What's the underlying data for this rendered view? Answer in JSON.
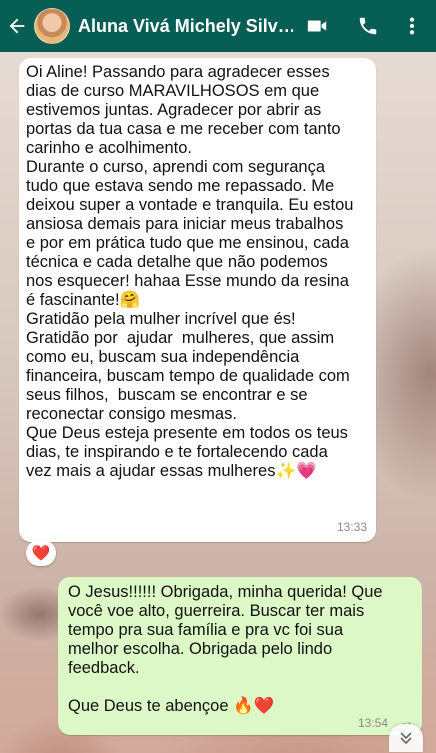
{
  "header": {
    "contact_name": "Aluna Vivá Michely Silv…",
    "back_icon": "arrow-left-icon",
    "video_icon": "video-camera-icon",
    "call_icon": "phone-icon",
    "menu_icon": "more-vertical-icon",
    "bg_color": "#075e54"
  },
  "messages": [
    {
      "direction": "incoming",
      "text": "Oi Aline! Passando para agradecer esses\ndias de curso MARAVILHOSOS em que\nestivemos juntas. Agradecer por abrir as\nportas da tua casa e me receber com tanto\ncarinho e acolhimento.\nDurante o curso, aprendi com segurança\ntudo que estava sendo me repassado. Me\ndeixou super a vontade e tranquila. Eu estou\nansiosa demais para iniciar meus trabalhos\ne por em prática tudo que me ensinou, cada\ntécnica e cada detalhe que não podemos\nnos esquecer! hahaa Esse mundo da resina\né fascinante!🤗\nGratidão pela mulher incrível que és!\nGratidão por  ajudar  mulheres, que assim\ncomo eu, buscam sua independência\nfinanceira, buscam tempo de qualidade com\nseus filhos,  buscam se encontrar e se\nreconectar consigo mesmas.\nQue Deus esteja presente em todos os teus\ndias, te inspirando e te fortalecendo cada\nvez mais a ajudar essas mulheres✨💗",
      "time": "13:33",
      "reaction": "❤️",
      "bg_color": "#ffffff"
    },
    {
      "direction": "outgoing",
      "text": "O Jesus!!!!!! Obrigada, minha querida! Que\nvocê voe alto, guerreira. Buscar ter mais\ntempo pra sua família e pra vc foi sua\nmelhor escolha. Obrigada pelo lindo\nfeedback.\n\nQue Deus te abençoe 🔥❤️",
      "time": "13:54",
      "status_icon": "double-check-icon",
      "bg_color": "#dcf8c6"
    }
  ],
  "scroll_down_icon": "chevron-double-down-icon"
}
